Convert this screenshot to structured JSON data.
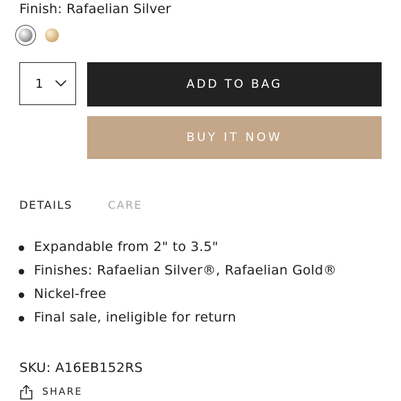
{
  "finish": {
    "label": "Finish:",
    "value": "Rafaelian Silver",
    "swatches": [
      {
        "name": "Rafaelian Silver",
        "color": "#9a9a9a",
        "selected": true
      },
      {
        "name": "Rafaelian Gold",
        "color": "#d9b98a",
        "selected": false
      }
    ]
  },
  "quantity": {
    "value": "1",
    "icon": "chevron-down-icon"
  },
  "actions": {
    "add_to_bag": "ADD TO BAG",
    "buy_now": "BUY IT NOW",
    "add_to_bag_color": "#222222",
    "buy_now_color": "#c4a689"
  },
  "tabs": [
    {
      "label": "DETAILS",
      "active": true
    },
    {
      "label": "CARE",
      "active": false
    }
  ],
  "details": {
    "bullets": [
      "Expandable from 2\" to 3.5\"",
      "Finishes: Rafaelian Silver®, Rafaelian Gold®",
      "Nickel-free",
      "Final sale, ineligible for return"
    ]
  },
  "sku": {
    "label": "SKU:",
    "value": "A16EB152RS"
  },
  "share": {
    "label": "SHARE",
    "icon": "share-icon"
  }
}
